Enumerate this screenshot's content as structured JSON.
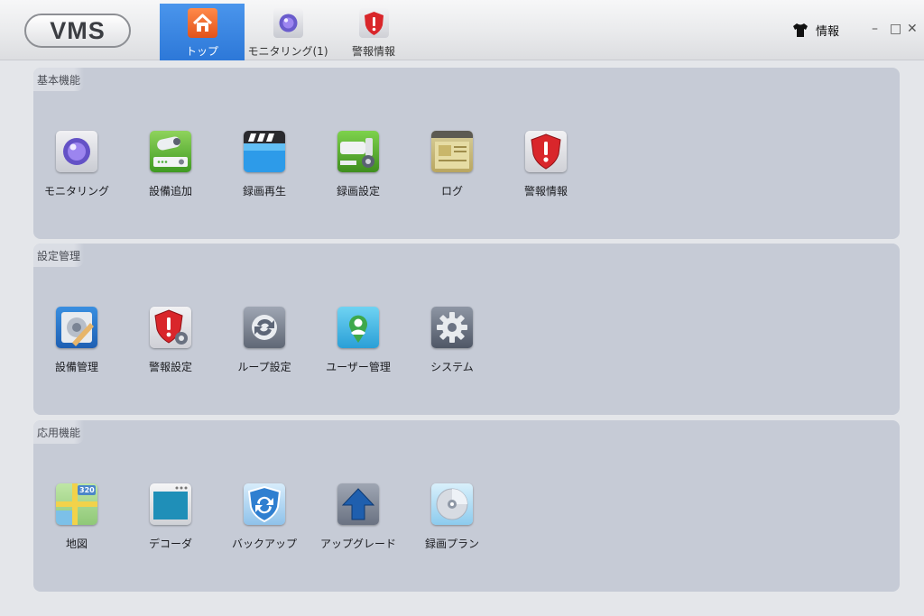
{
  "app": {
    "logo_text": "VMS"
  },
  "nav_tabs": [
    {
      "label": "トップ",
      "active": true,
      "icon": "home-icon"
    },
    {
      "label": "モニタリング(1)",
      "active": false,
      "icon": "camera-lens-icon"
    },
    {
      "label": "警報情報",
      "active": false,
      "icon": "alarm-shield-icon"
    }
  ],
  "header": {
    "info_label": "情報",
    "info_icon": "shirt-icon"
  },
  "window_controls": {
    "minimize": "–",
    "maximize": "□",
    "close": "✕"
  },
  "panels": [
    {
      "title": "基本機能",
      "items": [
        {
          "label": "モニタリング",
          "icon": "camera-lens-icon"
        },
        {
          "label": "設備追加",
          "icon": "add-device-icon"
        },
        {
          "label": "録画再生",
          "icon": "clapperboard-icon"
        },
        {
          "label": "録画設定",
          "icon": "record-settings-icon"
        },
        {
          "label": "ログ",
          "icon": "log-window-icon"
        },
        {
          "label": "警報情報",
          "icon": "alarm-shield-icon"
        }
      ]
    },
    {
      "title": "設定管理",
      "items": [
        {
          "label": "設備管理",
          "icon": "device-manage-icon"
        },
        {
          "label": "警報設定",
          "icon": "alarm-settings-icon"
        },
        {
          "label": "ループ設定",
          "icon": "loop-icon"
        },
        {
          "label": "ユーザー管理",
          "icon": "user-icon"
        },
        {
          "label": "システム",
          "icon": "gear-icon"
        }
      ]
    },
    {
      "title": "応用機能",
      "items": [
        {
          "label": "地図",
          "icon": "map-icon"
        },
        {
          "label": "デコーダ",
          "icon": "decoder-icon"
        },
        {
          "label": "バックアップ",
          "icon": "backup-icon"
        },
        {
          "label": "アップグレード",
          "icon": "upgrade-arrow-icon"
        },
        {
          "label": "録画プラン",
          "icon": "disc-icon"
        }
      ]
    }
  ],
  "colors": {
    "active_tab": "#2d78d8",
    "panel_bg": "#c6cbd6",
    "alarm_red": "#d9262b"
  },
  "map_badge": "320"
}
